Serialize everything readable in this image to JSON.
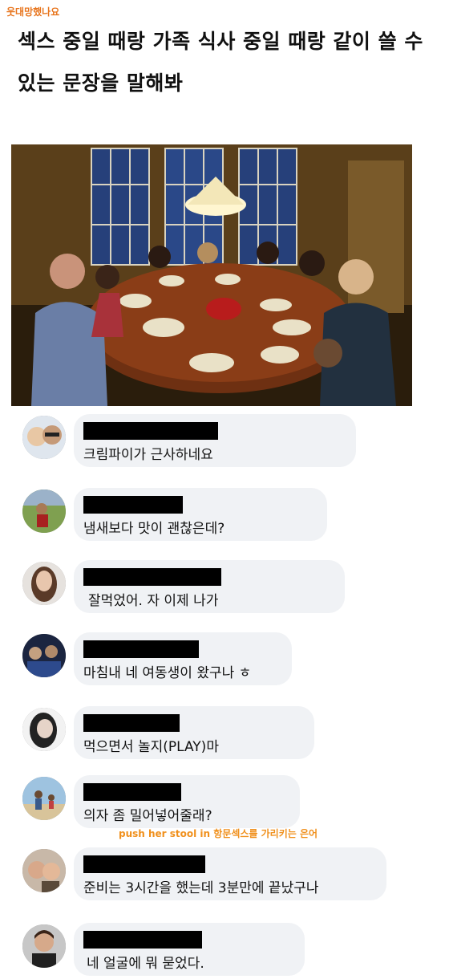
{
  "watermark": "웃대망했나요",
  "title": "섹스 중일 때랑 가족 식사 중일 때랑 같이 쓸 수 있는 문장을 말해봐",
  "photo": {
    "alt": "family dinner photo"
  },
  "comments": [
    {
      "text": "크림파이가 근사하네요"
    },
    {
      "text": "냄새보다 맛이 괜찮은데?"
    },
    {
      "text": "잘먹었어. 자 이제 나가"
    },
    {
      "text": "마침내 네 여동생이 왔구나 ㅎ"
    },
    {
      "text": "먹으면서 놀지(PLAY)마"
    },
    {
      "text": "의자 좀 밀어넣어줄래?"
    },
    {
      "text": "준비는 3시간을 했는데 3분만에 끝났구나"
    },
    {
      "text": "네 얼굴에 뭐 묻었다."
    }
  ],
  "note": "push her stool in 항문섹스를 가리키는 은어",
  "colors": {
    "bubble": "#f0f2f5",
    "redaction": "#000000",
    "watermark": "#e8761f",
    "note": "#f0901c"
  }
}
